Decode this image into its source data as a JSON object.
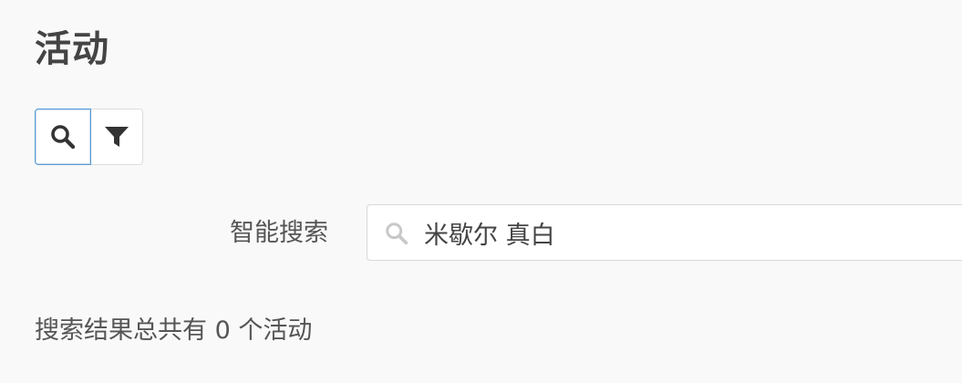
{
  "page": {
    "title": "活动"
  },
  "toolbar": {
    "search_icon": "search-icon",
    "filter_icon": "filter-icon"
  },
  "smart_search": {
    "label": "智能搜索",
    "value": "米歇尔 真白",
    "icon": "search-icon"
  },
  "results": {
    "summary": "搜索结果总共有 0 个活动"
  },
  "colors": {
    "background": "#f9f9f9",
    "text": "#444444",
    "active_border": "#5b9bd5"
  }
}
